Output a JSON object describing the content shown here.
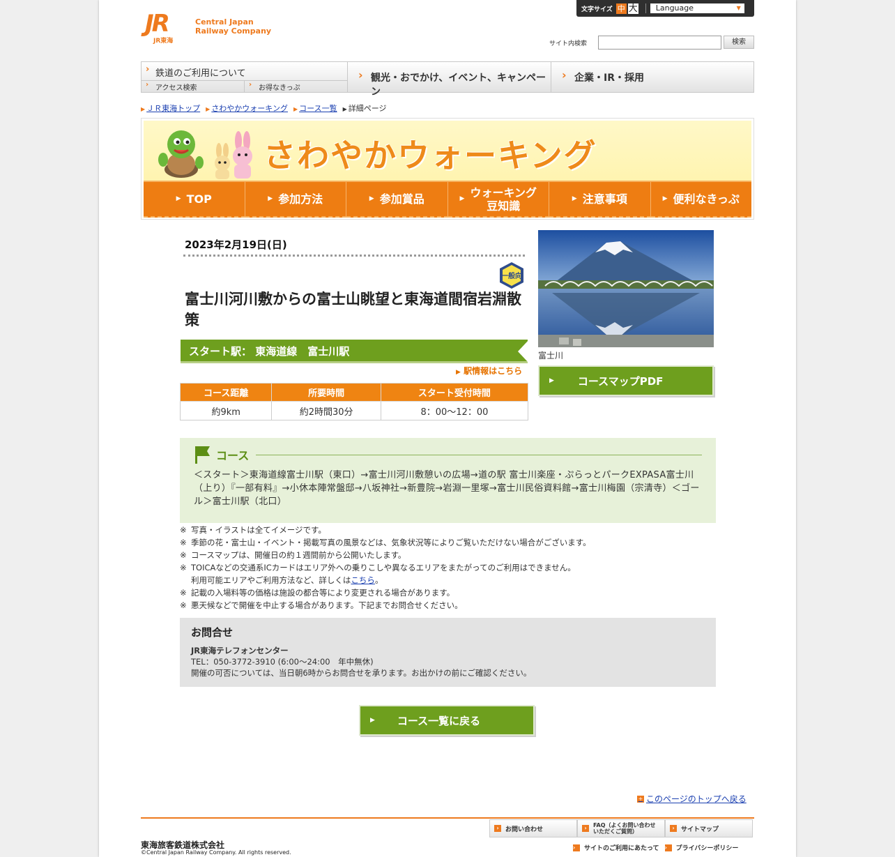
{
  "header": {
    "logo_jr": "JR",
    "logo_sub": "JR東海",
    "logo_line1": "Central Japan",
    "logo_line2": "Railway Company",
    "font_size_label": "文字サイズ",
    "font_size_mid": "中",
    "font_size_big": "大",
    "language_label": "Language",
    "search_label": "サイト内検索",
    "search_value": "",
    "search_button": "検索"
  },
  "global_nav": {
    "railway": "鉄道のご利用について",
    "access": "アクセス検索",
    "tickets": "お得なきっぷ",
    "tourism": "観光・おでかけ、イベント、キャンペーン",
    "corporate": "企業・IR・採用"
  },
  "breadcrumb": [
    "ＪＲ東海トップ",
    "さわやかウォーキング",
    "コース一覧",
    "詳細ページ"
  ],
  "banner": {
    "title": "さわやかウォーキング",
    "nav": [
      "TOP",
      "参加方法",
      "参加賞品",
      "ウォーキング\n豆知識",
      "注意事項",
      "便利なきっぷ"
    ]
  },
  "event": {
    "date": "2023年2月19日(日)",
    "badge": "一般向",
    "title": "富士川河川敷からの富士山眺望と東海道間宿岩淵散策",
    "start_station": "スタート駅：  東海道線　富士川駅",
    "station_link": "駅情報はこちら",
    "table_headers": [
      "コース距離",
      "所要時間",
      "スタート受付時間"
    ],
    "table_values": [
      "約9km",
      "約2時間30分",
      "8：00～12：00"
    ],
    "photo_caption": "富士川",
    "pdf_button": "コースマップPDF"
  },
  "course": {
    "heading": "コース",
    "route": "＜スタート＞東海道線富士川駅（東口）→富士川河川敷憩いの広場→道の駅 富士川楽座・ぷらっとパークEXPASA富士川（上り）『一部有料』→小休本陣常盤邸→八坂神社→新豊院→岩淵一里塚→富士川民俗資料館→富士川梅園（宗清寺）＜ゴール＞富士川駅（北口）"
  },
  "notes": {
    "n1": "写真・イラストは全てイメージです。",
    "n2": "季節の花・富士山・イベント・掲載写真の風景などは、気象状況等によりご覧いただけない場合がございます。",
    "n3": "コースマップは、開催日の約１週間前から公開いたします。",
    "n4a": "TOICAなどの交通系ICカードはエリア外への乗りこしや異なるエリアをまたがってのご利用はできません。",
    "n4b": "利用可能エリアやご利用方法など、詳しくは",
    "n4link": "こちら",
    "n4c": "。",
    "n5": "記載の入場料等の価格は施設の都合等により変更される場合があります。",
    "n6": "悪天候などで開催を中止する場合があります。下記までお問合せください。"
  },
  "contact": {
    "heading": "お問合せ",
    "name": "JR東海テレフォンセンター",
    "tel": "TEL：050-3772-3910 (6:00～24:00　年中無休)",
    "note": "開催の可否については、当日朝6時からお問合せを承ります。お出かけの前にご確認ください。"
  },
  "back_button": "コース一覧に戻る",
  "page_top": "このページのトップへ戻る",
  "footer": {
    "inquiry": "お問い合わせ",
    "faq_1": "FAQ（よくお問い合わせ",
    "faq_2": "いただくご質問）",
    "sitemap": "サイトマップ",
    "terms": "サイトのご利用にあたって",
    "privacy": "プライバシーポリシー",
    "company": "東海旅客鉄道株式会社",
    "copyright": "©Central Japan Railway Company. All rights reserved."
  },
  "colors": {
    "brand_orange": "#ee7a1e",
    "course_green": "#6e9f1e",
    "course_bg": "#e7f1d9"
  }
}
